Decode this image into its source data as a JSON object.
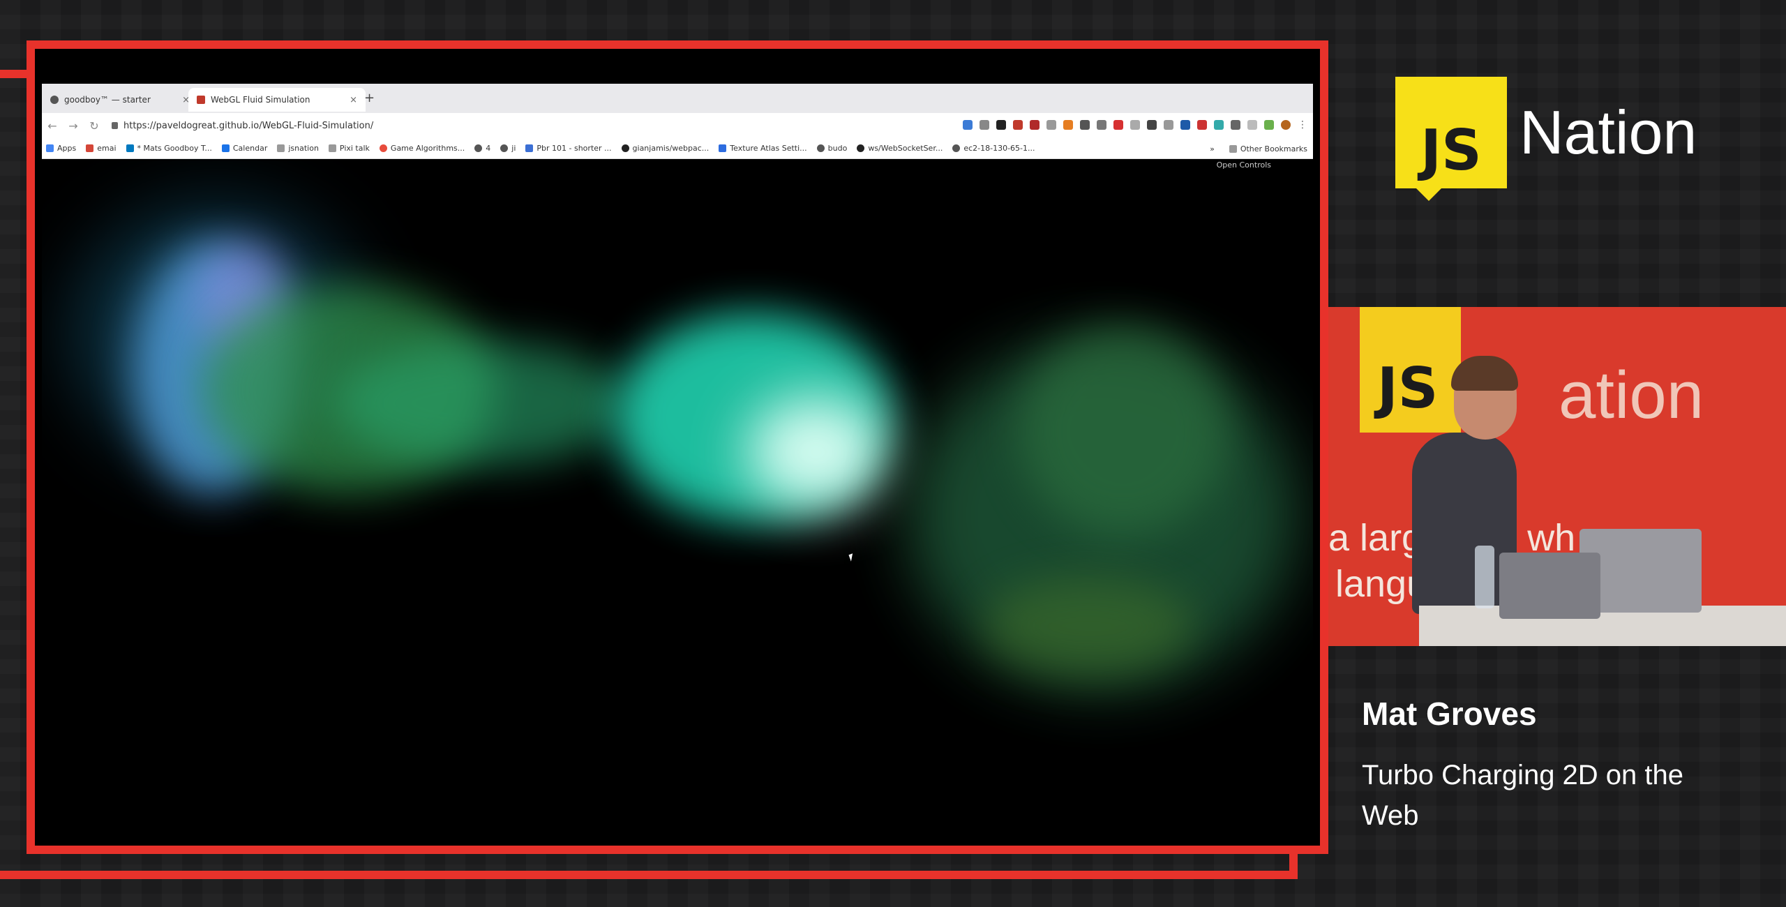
{
  "browser": {
    "tabs": [
      {
        "label": "goodboy™ — starter"
      },
      {
        "label": "WebGL Fluid Simulation"
      }
    ],
    "new_tab": "+",
    "close": "×",
    "url": "https://paveldogreat.github.io/WebGL-Fluid-Simulation/",
    "bookmarks": [
      "Apps",
      "emai",
      "* Mats Goodboy T...",
      "Calendar",
      "jsnation",
      "Pixi talk",
      "Game Algorithms...",
      "4",
      "ji",
      "Pbr 101 - shorter ...",
      "gianjamis/webpac...",
      "Texture Atlas Setti...",
      "budo",
      "ws/WebSocketSer...",
      "ec2-18-130-65-1..."
    ],
    "bookmarks_more": "»",
    "other_bookmarks": "Other Bookmarks"
  },
  "canvas": {
    "open_controls": "Open Controls"
  },
  "brand": {
    "logo_mark": "JS",
    "logo_text": "Nation"
  },
  "camera": {
    "logo_mark": "JS",
    "backdrop_word": "ation",
    "backdrop_line1": "a large of         e wh",
    "backdrop_line2": "langua                 and"
  },
  "speaker": {
    "name": "Mat Groves",
    "talk_title": "Turbo Charging 2D on the Web"
  },
  "colors": {
    "frame_red": "#e8322b",
    "brand_yellow": "#f7e018"
  }
}
